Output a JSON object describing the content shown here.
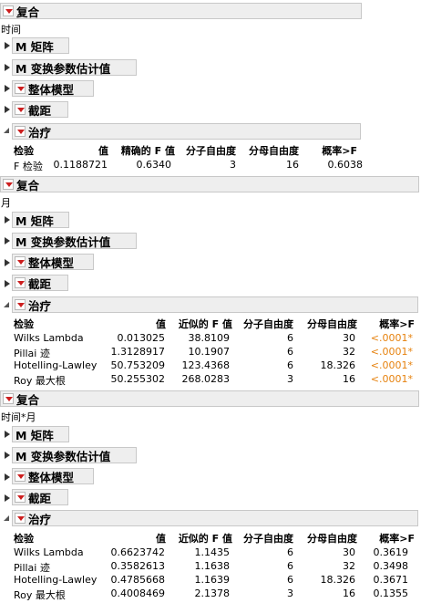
{
  "sections": [
    {
      "title": "复合",
      "effect": "时间",
      "rows": [
        "M 矩阵",
        "M 变换参数估计值",
        "整体模型",
        "截距",
        "治疗"
      ],
      "headers": [
        "检验",
        "值",
        "精确的 F 值",
        "分子自由度",
        "分母自由度",
        "概率>F"
      ],
      "data": [
        [
          "F 检验",
          "0.1188721",
          "0.6340",
          "3",
          "16",
          "0.6038"
        ]
      ]
    },
    {
      "title": "复合",
      "effect": "月",
      "rows": [
        "M 矩阵",
        "M 变换参数估计值",
        "整体模型",
        "截距",
        "治疗"
      ],
      "headers": [
        "检验",
        "值",
        "近似的 F 值",
        "分子自由度",
        "分母自由度",
        "概率>F"
      ],
      "data": [
        [
          "Wilks Lambda",
          "0.013025",
          "38.8109",
          "6",
          "30",
          "<.0001*"
        ],
        [
          "Pillai 迹",
          "1.3128917",
          "10.1907",
          "6",
          "32",
          "<.0001*"
        ],
        [
          "Hotelling-Lawley",
          "50.753209",
          "123.4368",
          "6",
          "18.326",
          "<.0001*"
        ],
        [
          "Roy 最大根",
          "50.255302",
          "268.0283",
          "3",
          "16",
          "<.0001*"
        ]
      ]
    },
    {
      "title": "复合",
      "effect": "时间*月",
      "rows": [
        "M 矩阵",
        "M 变换参数估计值",
        "整体模型",
        "截距",
        "治疗"
      ],
      "headers": [
        "检验",
        "值",
        "近似的 F 值",
        "分子自由度",
        "分母自由度",
        "概率>F"
      ],
      "data": [
        [
          "Wilks Lambda",
          "0.6623742",
          "1.1435",
          "6",
          "30",
          "0.3619"
        ],
        [
          "Pillai 迹",
          "0.3582613",
          "1.1638",
          "6",
          "32",
          "0.3498"
        ],
        [
          "Hotelling-Lawley",
          "0.4785668",
          "1.1639",
          "6",
          "18.326",
          "0.3671"
        ],
        [
          "Roy 最大根",
          "0.4008469",
          "2.1378",
          "3",
          "16",
          "0.1355"
        ]
      ]
    }
  ],
  "colors": {
    "significant": "#e6820e",
    "menu_triangle": "#cc1e1e"
  }
}
